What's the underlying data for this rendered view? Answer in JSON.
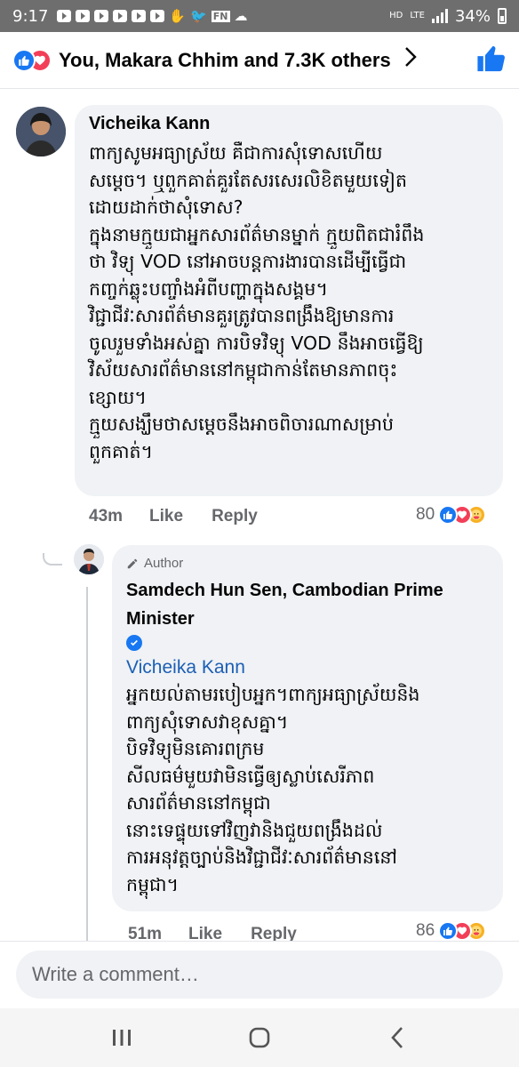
{
  "status_bar": {
    "time": "9:17",
    "network": "HD",
    "lte": "LTE",
    "battery": "34%"
  },
  "reactions_header": {
    "summary": "You, Makara Chhim and 7.3K others",
    "icons": [
      "like-icon",
      "love-icon"
    ]
  },
  "comment": {
    "author": "Vicheika Kann",
    "body": "ពាក្យសូមអធ្យាស្រ័យ គឺជាការសុំទោសហើយ\nសម្ដេច។ ឬពួកគាត់គួរតែសរសេរលិខិតមួយទៀត\nដោយដាក់ថាសុំទោស?\nក្នុងនាមក្មួយជាអ្នកសារព័ត៌មានម្នាក់ ក្មួយពិតជារំពឹង\nថា វិទ្យុ VOD នៅអាចបន្តការងារបានដើម្បីធ្វើជា\nកញ្ចក់ឆ្លុះបញ្ចាំងអំពីបញ្ហាក្នុងសង្គម។\nវិជ្ជាជីវៈសារព័ត៌មានគួរត្រូវបានពង្រឹងឱ្យមានការ\nចូលរួមទាំងអស់គ្នា ការបិទវិទ្យុ VOD នឹងអាចធ្វើឱ្យ\nវិស័យសារព័ត៌មាននៅកម្ពុជាកាន់តែមានភាពចុះ\nខ្សោយ។\nក្មួយសង្ឃឹមថាសម្ដេចនឹងអាចពិចារណាសម្រាប់\nពួកគាត់។",
    "time": "43m",
    "like_label": "Like",
    "reply_label": "Reply",
    "reaction_count": "80"
  },
  "reply": {
    "badge": "Author",
    "author": "Samdech Hun Sen, Cambodian Prime Minister",
    "mention": "Vicheika Kann",
    "body": "អ្នកយល់តាមរបៀបអ្នក។ពាក្យអធ្យាស្រ័យនិង\nពាក្យសុំទោសវាខុសគ្នា។\nបិទវិទ្យុមិនគោរពក្រម\nសីលធម៌មួយវាមិនធ្វើឲ្យស្លាប់សេរីភាព\nសារព័ត៌មាននៅកម្ពុជា\nនោះទេផ្ទុយទៅវិញវានិងជួយពង្រឹងដល់\nការអនុវត្តច្បាប់និងវិជ្ជាជីវៈសារព័ត៌មាននៅ\nកម្ពុជា។",
    "time": "51m",
    "like_label": "Like",
    "reply_label": "Reply",
    "reaction_count": "86"
  },
  "composer": {
    "placeholder": "Write a comment…"
  },
  "colors": {
    "facebook_blue": "#1877f2",
    "love_red": "#f33e58",
    "care_yellow": "#f7b125",
    "bubble_gray": "#f0f2f5",
    "meta_gray": "#65676b",
    "mention_blue": "#1b5fb5"
  }
}
